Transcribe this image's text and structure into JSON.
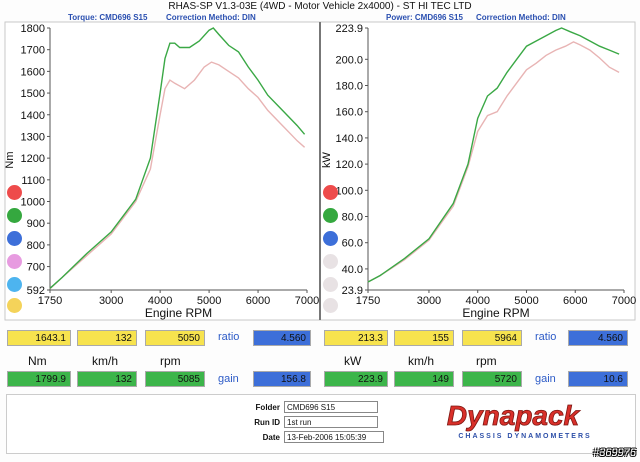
{
  "header": {
    "title": "RHAS-SP V1.3-03E  (4WD - Motor Vehicle 2x4000) - ST HI TEC LTD"
  },
  "left_panel": {
    "title": "Torque: CMD696 S15",
    "correction": "Correction Method: DIN"
  },
  "right_panel": {
    "title": "Power: CMD696 S15",
    "correction": "Correction Method: DIN"
  },
  "legend_colors": {
    "left": [
      "#ee4b4b",
      "#35a83f",
      "#3d6fd9",
      "#e79be0",
      "#4db4ef",
      "#f4d35a"
    ],
    "right": [
      "#ee4b4b",
      "#35a83f",
      "#3d6fd9",
      "#e8e2e4",
      "#e8e2e4",
      "#e8e2e4"
    ]
  },
  "chart_data": [
    {
      "type": "line",
      "xlabel": "Engine RPM",
      "ylabel": "Nm",
      "xlim": [
        1750,
        7000
      ],
      "ylim": [
        592,
        1800
      ],
      "x_ticks": [
        "1750",
        "3000",
        "4000",
        "5000",
        "6000",
        "7000"
      ],
      "y_ticks": [
        "592",
        "700",
        "800",
        "900",
        "1000",
        "1100",
        "1200",
        "1300",
        "1400",
        "1500",
        "1600",
        "1700",
        "1800"
      ],
      "series": [
        {
          "color": "#3aa845",
          "points": [
            [
              1750,
              600
            ],
            [
              2000,
              650
            ],
            [
              2500,
              760
            ],
            [
              3000,
              860
            ],
            [
              3500,
              1010
            ],
            [
              3800,
              1200
            ],
            [
              4000,
              1500
            ],
            [
              4100,
              1660
            ],
            [
              4200,
              1730
            ],
            [
              4300,
              1730
            ],
            [
              4400,
              1710
            ],
            [
              4600,
              1710
            ],
            [
              4800,
              1740
            ],
            [
              5000,
              1790
            ],
            [
              5085,
              1800
            ],
            [
              5200,
              1770
            ],
            [
              5400,
              1720
            ],
            [
              5600,
              1690
            ],
            [
              5800,
              1620
            ],
            [
              6000,
              1560
            ],
            [
              6200,
              1490
            ],
            [
              6500,
              1420
            ],
            [
              6800,
              1350
            ],
            [
              6950,
              1310
            ]
          ]
        },
        {
          "color": "#e8b4b4",
          "points": [
            [
              1750,
              598
            ],
            [
              2000,
              650
            ],
            [
              2500,
              750
            ],
            [
              3000,
              850
            ],
            [
              3500,
              1000
            ],
            [
              3800,
              1150
            ],
            [
              4000,
              1400
            ],
            [
              4100,
              1520
            ],
            [
              4200,
              1560
            ],
            [
              4300,
              1545
            ],
            [
              4500,
              1520
            ],
            [
              4700,
              1560
            ],
            [
              4900,
              1620
            ],
            [
              5050,
              1643
            ],
            [
              5200,
              1630
            ],
            [
              5400,
              1600
            ],
            [
              5600,
              1570
            ],
            [
              5800,
              1520
            ],
            [
              6000,
              1480
            ],
            [
              6200,
              1420
            ],
            [
              6500,
              1350
            ],
            [
              6800,
              1280
            ],
            [
              6950,
              1250
            ]
          ]
        }
      ]
    },
    {
      "type": "line",
      "xlabel": "Engine RPM",
      "ylabel": "kW",
      "xlim": [
        1750,
        7000
      ],
      "ylim": [
        23.9,
        223.9
      ],
      "x_ticks": [
        "1750",
        "3000",
        "4000",
        "5000",
        "6000",
        "7000"
      ],
      "y_ticks": [
        "23.9",
        "40.0",
        "60.0",
        "80.0",
        "100.0",
        "120.0",
        "140.0",
        "160.0",
        "180.0",
        "200.0",
        "223.9"
      ],
      "series": [
        {
          "color": "#3aa845",
          "points": [
            [
              1750,
              30
            ],
            [
              2000,
              35
            ],
            [
              2500,
              48
            ],
            [
              3000,
              63
            ],
            [
              3500,
              90
            ],
            [
              3800,
              120
            ],
            [
              4000,
              155
            ],
            [
              4200,
              172
            ],
            [
              4400,
              178
            ],
            [
              4600,
              190
            ],
            [
              4800,
              200
            ],
            [
              5000,
              210
            ],
            [
              5200,
              214
            ],
            [
              5400,
              218
            ],
            [
              5600,
              222
            ],
            [
              5720,
              223.9
            ],
            [
              5900,
              221
            ],
            [
              6100,
              218
            ],
            [
              6300,
              214
            ],
            [
              6500,
              210
            ],
            [
              6700,
              207
            ],
            [
              6900,
              204
            ]
          ]
        },
        {
          "color": "#e8b4b4",
          "points": [
            [
              1750,
              30
            ],
            [
              2000,
              35
            ],
            [
              2500,
              47
            ],
            [
              3000,
              62
            ],
            [
              3500,
              88
            ],
            [
              3800,
              118
            ],
            [
              4000,
              145
            ],
            [
              4200,
              157
            ],
            [
              4400,
              160
            ],
            [
              4600,
              172
            ],
            [
              4800,
              182
            ],
            [
              5000,
              192
            ],
            [
              5200,
              197
            ],
            [
              5400,
              203
            ],
            [
              5600,
              207
            ],
            [
              5800,
              210
            ],
            [
              5964,
              213.3
            ],
            [
              6100,
              211
            ],
            [
              6300,
              207
            ],
            [
              6500,
              201
            ],
            [
              6700,
              194
            ],
            [
              6900,
              190
            ]
          ]
        }
      ]
    }
  ],
  "readouts": {
    "left_top": [
      "1643.1",
      "132",
      "5050"
    ],
    "left_units": [
      "Nm",
      "km/h",
      "rpm"
    ],
    "left_bottom": [
      "1799.9",
      "132",
      "5085"
    ],
    "right_top": [
      "213.3",
      "155",
      "5964"
    ],
    "right_units": [
      "kW",
      "km/h",
      "rpm"
    ],
    "right_bottom": [
      "223.9",
      "149",
      "5720"
    ],
    "ratio_label": "ratio",
    "gain_label": "gain",
    "left_ratio": "4.560",
    "left_gain": "156.8",
    "right_ratio": "4.560",
    "right_gain": "10.6"
  },
  "info": {
    "folder_label": "Folder",
    "folder_value": "CMD696 S15",
    "runid_label": "Run ID",
    "runid_value": "1st run",
    "date_label": "Date",
    "date_value": "13-Feb-2006   15:05:39"
  },
  "logo": {
    "name": "Dynapack",
    "sub": "CHASSIS DYNAMOMETERS"
  },
  "watermark": "#369976"
}
